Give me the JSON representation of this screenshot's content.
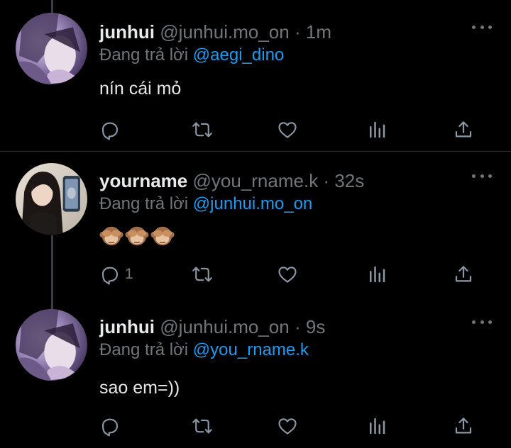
{
  "colors": {
    "background": "#000000",
    "text": "#e7e9ea",
    "muted": "#71767b",
    "mention": "#1d9bf0",
    "divider": "#2f3336"
  },
  "tweets": [
    {
      "display_name": "junhui",
      "handle": "@junhui.mo_on",
      "separator": "·",
      "time": "1m",
      "replying_prefix": "Đang trả lời",
      "replying_to": "@aegi_dino",
      "text": "nín cái mỏ",
      "reply_count": "",
      "avatar": "avatar-purple-portrait"
    },
    {
      "display_name": "yourname",
      "handle": "@you_rname.k",
      "separator": "·",
      "time": "32s",
      "replying_prefix": "Đang trả lời",
      "replying_to": "@junhui.mo_on",
      "text": "",
      "emojis": [
        "see-no-evil-monkey",
        "see-no-evil-monkey",
        "see-no-evil-monkey"
      ],
      "reply_count": "1",
      "avatar": "avatar-girl-selfie"
    },
    {
      "display_name": "junhui",
      "handle": "@junhui.mo_on",
      "separator": "·",
      "time": "9s",
      "replying_prefix": "Đang trả lời",
      "replying_to": "@you_rname.k",
      "text": "sao em=))",
      "reply_count": "",
      "avatar": "avatar-purple-portrait"
    }
  ],
  "action_icons": [
    "reply-icon",
    "retweet-icon",
    "like-icon",
    "analytics-icon",
    "share-icon"
  ],
  "menu_icon": "more-options-icon"
}
